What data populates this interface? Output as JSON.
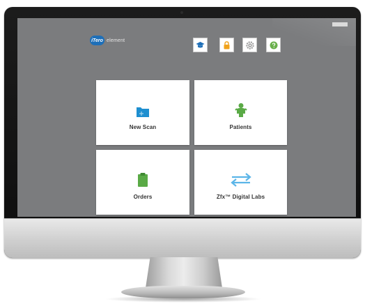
{
  "app": {
    "logo_badge": "iTero",
    "logo_text": "element",
    "brand_color": "#1e6fb8"
  },
  "toolbar": {
    "buttons": [
      {
        "name": "training",
        "icon": "graduation-cap-icon",
        "color": "#1e6fb8"
      },
      {
        "name": "lock",
        "icon": "lock-icon",
        "color": "#f0a21b"
      },
      {
        "name": "settings",
        "icon": "gear-icon",
        "color": "#9a9a9a"
      },
      {
        "name": "help",
        "icon": "question-icon",
        "color": "#6ab04c"
      }
    ]
  },
  "tiles": [
    {
      "label": "New Scan",
      "icon": "folder-icon",
      "color": "#1e8fd0"
    },
    {
      "label": "Patients",
      "icon": "person-icon",
      "color": "#5aaa46"
    },
    {
      "label": "Orders",
      "icon": "clipboard-icon",
      "color": "#5aaa46"
    },
    {
      "label": "Zfx™ Digital Labs",
      "icon": "swap-arrows-icon",
      "color": "#5bb5e8"
    }
  ],
  "colors": {
    "screen_background": "#7b7c7e",
    "tile_background": "#ffffff"
  }
}
